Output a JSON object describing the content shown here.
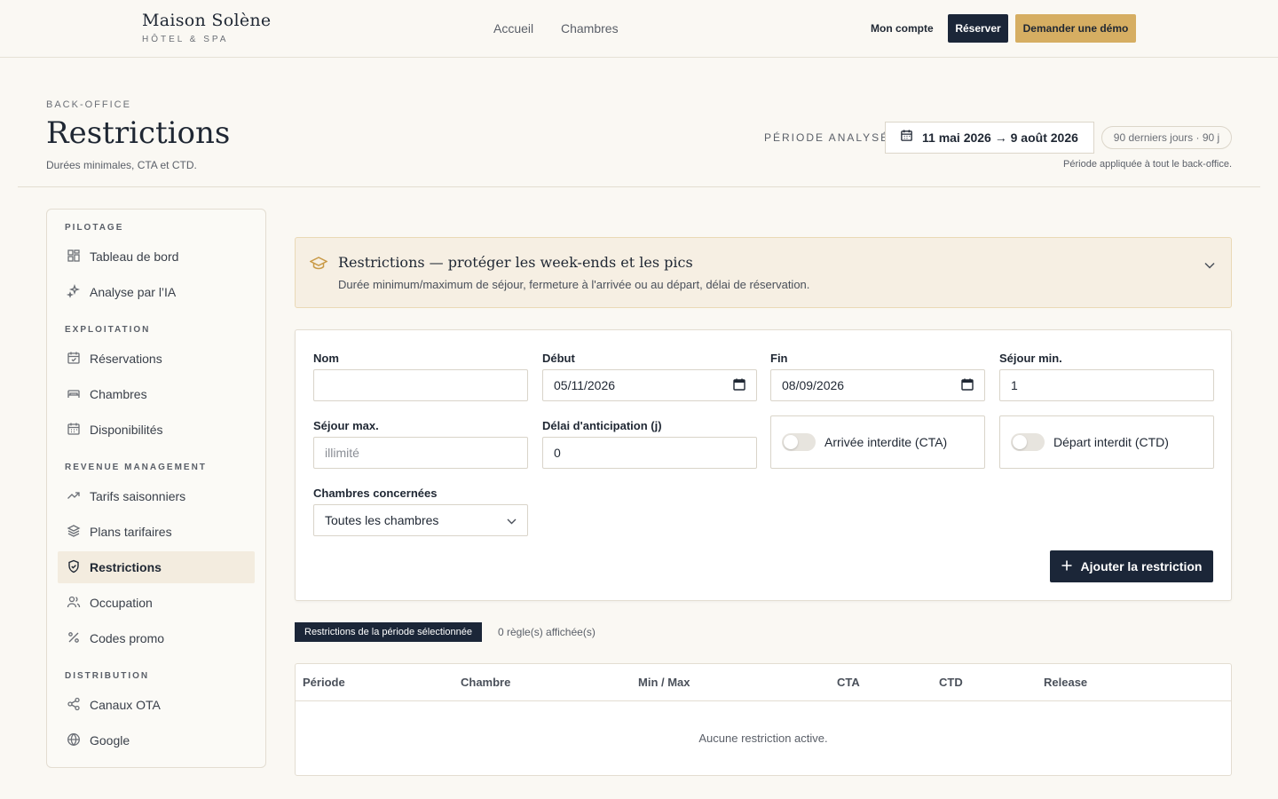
{
  "topnav": {
    "brand_name": "Maison Solène",
    "brand_sub": "HÔTEL & SPA",
    "links": [
      "Accueil",
      "Chambres"
    ],
    "account_label": "Mon compte",
    "reserve_label": "Réserver",
    "demo_label": "Demander une démo"
  },
  "header": {
    "eyebrow": "BACK-OFFICE",
    "title": "Restrictions",
    "subtitle": "Durées minimales, CTA et CTD.",
    "period_label": "PÉRIODE ANALYSÉE",
    "period_value": "11 mai 2026 → 9 août 2026",
    "period_pill": "90 derniers jours · 90 j",
    "period_note": "Période appliquée à tout le back-office."
  },
  "sidebar": {
    "sections": [
      {
        "title": "PILOTAGE",
        "items": [
          "Tableau de bord",
          "Analyse par l’IA"
        ]
      },
      {
        "title": "EXPLOITATION",
        "items": [
          "Réservations",
          "Chambres",
          "Disponibilités"
        ]
      },
      {
        "title": "REVENUE MANAGEMENT",
        "items": [
          "Tarifs saisonniers",
          "Plans tarifaires",
          "Restrictions",
          "Occupation",
          "Codes promo"
        ]
      },
      {
        "title": "DISTRIBUTION",
        "items": [
          "Canaux OTA",
          "Google"
        ]
      }
    ],
    "active_item": "Restrictions"
  },
  "banner": {
    "title": "Restrictions — protéger les week-ends et les pics",
    "description": "Durée minimum/maximum de séjour, fermeture à l'arrivée ou au départ, délai de réservation."
  },
  "form": {
    "name_label": "Nom",
    "name_value": "",
    "start_label": "Début",
    "start_value": "05/11/2026",
    "end_label": "Fin",
    "end_value": "08/09/2026",
    "min_stay_label": "Séjour min.",
    "min_stay_value": "1",
    "max_stay_label": "Séjour max.",
    "max_stay_placeholder": "illimité",
    "lead_label": "Délai d'anticipation (j)",
    "lead_value": "0",
    "cta_label": "Arrivée interdite (CTA)",
    "ctd_label": "Départ interdit (CTD)",
    "rooms_label": "Chambres concernées",
    "rooms_value": "Toutes les chambres",
    "submit_label": "Ajouter la restriction"
  },
  "list": {
    "tag": "Restrictions de la période sélectionnée",
    "count": "0 règle(s) affichée(s)",
    "columns": [
      "Période",
      "Chambre",
      "Min / Max",
      "CTA",
      "CTD",
      "Release"
    ],
    "empty": "Aucune restriction active."
  }
}
